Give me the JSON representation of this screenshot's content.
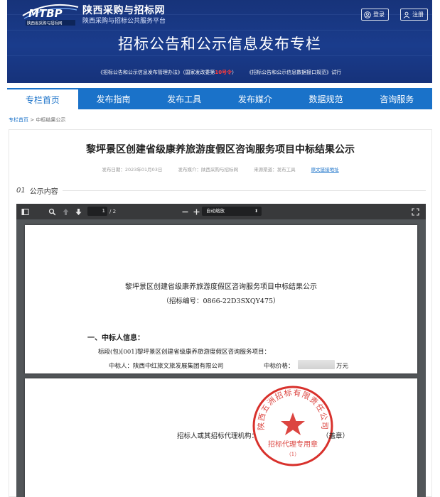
{
  "header": {
    "logo_text": "MTBP",
    "logo_caption": "陕西省采购与招标网",
    "site_name": "陕西采购与招标网",
    "site_subtitle": "陕西采购与招标公共服务平台",
    "login_label": "登录",
    "register_label": "注册",
    "banner_title": "招标公告和公示信息发布专栏",
    "note_part1": "《招标公告和公示信息发布管理办法》（国家发改委第",
    "note_number": "10号令",
    "note_part2": "）",
    "note_part3": "《招标公告和公示信息数据接口规范》试行"
  },
  "nav": {
    "items": [
      {
        "label": "专栏首页"
      },
      {
        "label": "发布指南"
      },
      {
        "label": "发布工具"
      },
      {
        "label": "发布媒介"
      },
      {
        "label": "数据规范"
      },
      {
        "label": "咨询服务"
      }
    ]
  },
  "breadcrumb": {
    "home": "专栏首页",
    "separator": ">",
    "current": "中标结果公示"
  },
  "article": {
    "title": "黎坪景区创建省级康养旅游度假区咨询服务项目中标结果公示",
    "publish_date": "发布日期：2023年01月03日",
    "media": "发布媒介：陕西采购与招标网",
    "channel": "来源渠道：发布工具",
    "original_link": "原文链接地址",
    "section_number": "01",
    "section_label": "公示内容"
  },
  "pdf": {
    "current_page": "1",
    "page_count": "/ 2",
    "zoom": "自动缩放",
    "doc_title": "黎坪景区创建省级康养旅游度假区咨询服务项目中标结果公示",
    "doc_code": "（招标编号：0866-22D3SXQY475）",
    "section_heading": "一、中标人信息：",
    "lot_line": "标段(包)[001]黎坪景区创建省级康养旅游度假区咨询服务项目：",
    "winner_line": "中标人：陕西中红旅文旅发展集团有限公司",
    "price_label": "中标价格：",
    "price_unit": "万元",
    "sign_line": "招标人或其招标代理机构：",
    "seal_suffix": "（盖章）",
    "seal_ring_text": "陕西五洲招标有限责任公司",
    "seal_center_text": "招标代理专用章",
    "seal_sub_text": "（1）"
  },
  "colors": {
    "banner_bg": "#1a3c8c",
    "nav_bg": "#1a72c9",
    "accent_red": "#ff3b3b",
    "seal_red": "#d8312c"
  }
}
